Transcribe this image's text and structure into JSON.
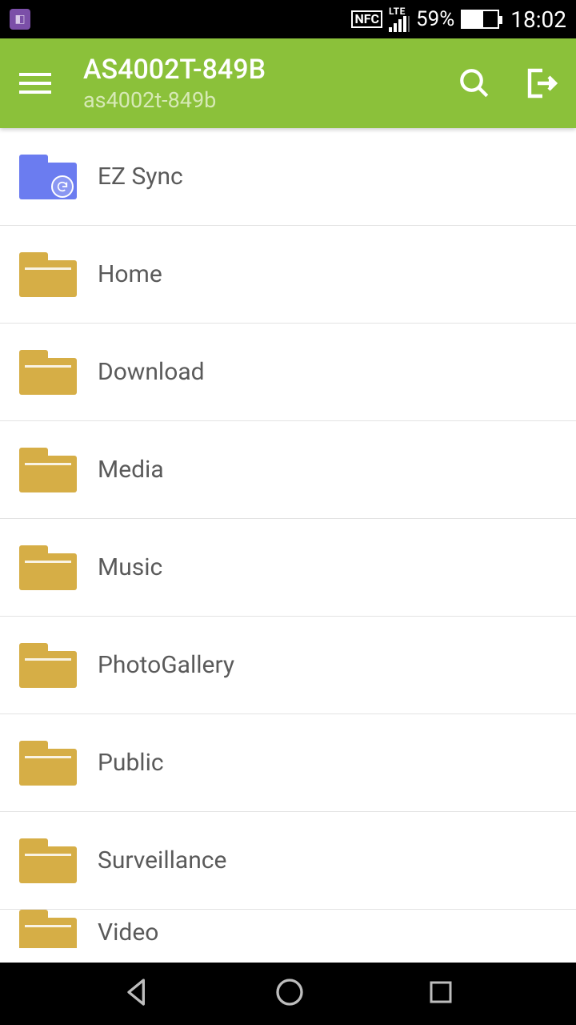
{
  "status": {
    "nfc": "NFC",
    "lte": "LTE",
    "battery_pct": "59%",
    "time": "18:02"
  },
  "appbar": {
    "title": "AS4002T-849B",
    "subtitle": "as4002t-849b"
  },
  "folders": [
    {
      "label": "EZ Sync",
      "icon": "sync"
    },
    {
      "label": "Home",
      "icon": "folder"
    },
    {
      "label": "Download",
      "icon": "folder"
    },
    {
      "label": "Media",
      "icon": "folder"
    },
    {
      "label": "Music",
      "icon": "folder"
    },
    {
      "label": "PhotoGallery",
      "icon": "folder"
    },
    {
      "label": "Public",
      "icon": "folder"
    },
    {
      "label": "Surveillance",
      "icon": "folder"
    },
    {
      "label": "Video",
      "icon": "folder"
    }
  ],
  "colors": {
    "accent": "#8bc13a",
    "folder": "#d6ae46",
    "sync_folder": "#6b7cf0"
  }
}
